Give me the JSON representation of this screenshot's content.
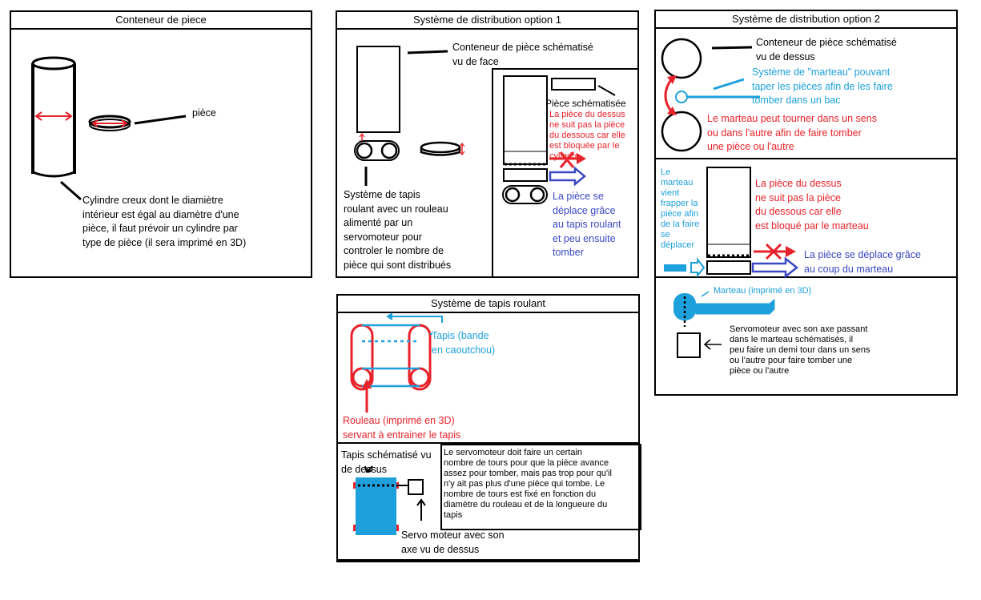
{
  "colors": {
    "red": "#e8222a",
    "blue": "#3a48c2",
    "cyan": "#1ea0dc",
    "black": "#000000"
  },
  "panel_container": {
    "title": "Conteneur de piece",
    "label_piece": "pièce",
    "cylinder_desc": "Cylindre creux dont le diamiètre\nintérieur est égal au diamètre d'une\npièce, il faut prévoir un cylindre par\ntype de pièce  (il sera imprimé en 3D)"
  },
  "panel_option1": {
    "title": "Système de distribution option 1",
    "label_container_front": "Conteneur de pièce schématisé\nvu de face",
    "belt_desc": "Système de tapis\nroulant avec un rouleau\nalimenté par un\nservomoteur pour\ncontroler le nombre de\npièce qui sont distribués",
    "label_piece_schematic": "Pièce schématisée",
    "red_note": "La pièce du dessus\nne suit pas la pièce\ndu dessous car elle\nest bloquée par le\n          cylindre",
    "blue_note": "La pièce se\ndéplace  grâce\nau tapis roulant\net peu ensuite\ntomber"
  },
  "panel_option2": {
    "title": "Système de distribution option 2",
    "label_container_top": "Conteneur de pièce schématisé\nvu de dessus",
    "hammer_desc": "Système de \"marteau\" pouvant\ntaper les pièces afin de les faire\ntomber dans un bac",
    "rotate_note": "Le marteau peut tourner dans un sens\nou dans l'autre afin de faire tomber\nune pièce ou l'autre",
    "hammer_side_note": "Le\nmarteau\nvient\nfrapper la\npièce afin\nde la faire\nse\ndéplacer",
    "red_note": "La pièce du dessus\nne suit pas la pièce\ndu dessous car elle\nest bloqué par le marteau",
    "blue_note": "La pièce se déplace grâce\nau coup du marteau",
    "hammer_label": "Marteau (imprimé en 3D)",
    "servo_desc": "Servomoteur avec son axe passant\ndans le marteau schématisés, il\npeu faire un demi tour dans un sens\nou l'autre pour faire tomber une\npièce ou l'autre"
  },
  "panel_belt": {
    "title": "Système de tapis roulant",
    "label_belt": "Tapis (bande\nen caoutchou)",
    "label_roller": "Rouleau (imprimé en 3D)\nservant à entrainer le tapis",
    "label_top_view": "Tapis schématisé vu\n      de dessus",
    "servo_label": "Servo moteur avec son\naxe vu de dessus",
    "turns_desc": "Le servomoteur doit faire un certain\nnombre de tours pour que la pièce avance\nassez pour tomber, mais pas trop pour qu'il\nn'y ait pas plus d'une pièce qui tombe. Le\nnombre de tours est fixé en fonction du\ndiamètre du rouleau et de la longueure du\ntapis"
  }
}
